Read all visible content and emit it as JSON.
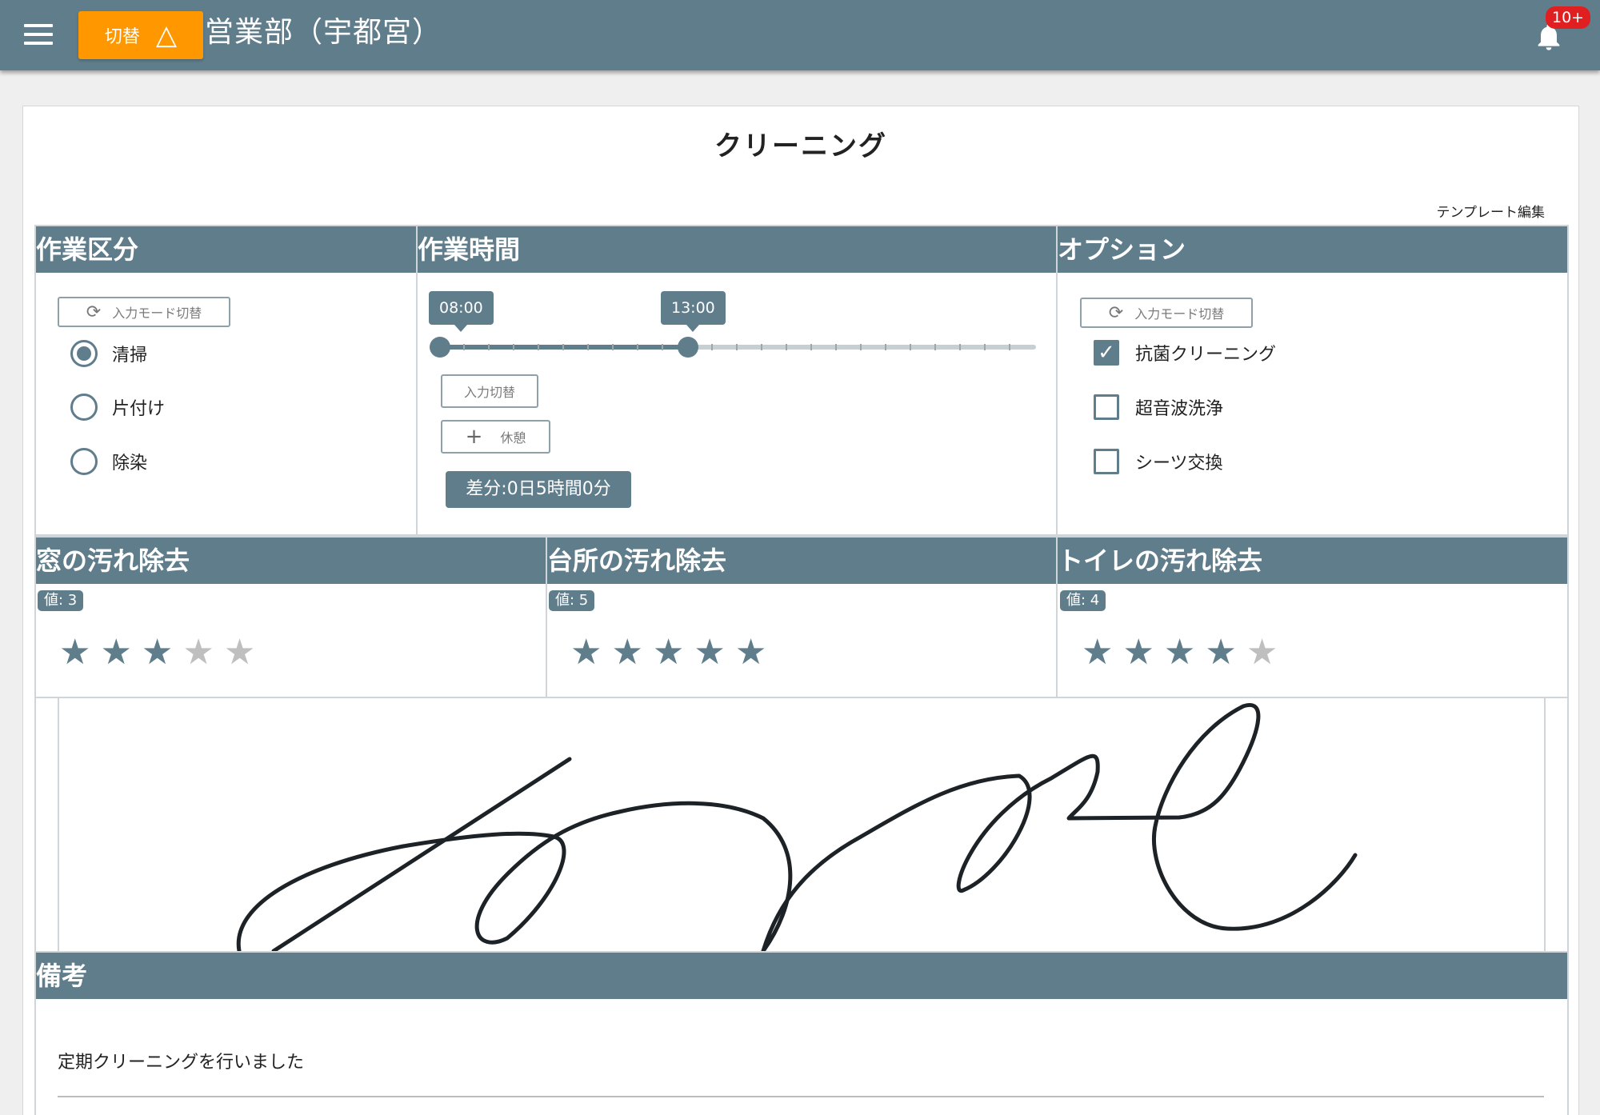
{
  "header": {
    "switch_label": "切替",
    "dept_title": "営業部（宇都宮）",
    "notification_count": "10+"
  },
  "page": {
    "title": "クリーニング",
    "template_edit": "テンプレート編集"
  },
  "work_type": {
    "title": "作業区分",
    "mode_toggle": "入力モード切替",
    "options": [
      "清掃",
      "片付け",
      "除染"
    ],
    "selected": "清掃"
  },
  "work_time": {
    "title": "作業時間",
    "start": "08:00",
    "end": "13:00",
    "input_toggle": "入力切替",
    "add_break": "休憩",
    "diff": "差分:0日5時間0分"
  },
  "options": {
    "title": "オプション",
    "mode_toggle": "入力モード切替",
    "items": [
      {
        "label": "抗菌クリーニング",
        "checked": true
      },
      {
        "label": "超音波洗浄",
        "checked": false
      },
      {
        "label": "シーツ交換",
        "checked": false
      }
    ]
  },
  "ratings": [
    {
      "title": "窓の汚れ除去",
      "value_label": "値: 3",
      "value": 3,
      "max": 5
    },
    {
      "title": "台所の汚れ除去",
      "value_label": "値: 5",
      "value": 5,
      "max": 5
    },
    {
      "title": "トイレの汚れ除去",
      "value_label": "値: 4",
      "value": 4,
      "max": 5
    }
  ],
  "remarks": {
    "title": "備考",
    "text": "定期クリーニングを行いました"
  },
  "colors": {
    "primary": "#607d8b",
    "accent": "#ff9800",
    "badge": "#e02020"
  }
}
